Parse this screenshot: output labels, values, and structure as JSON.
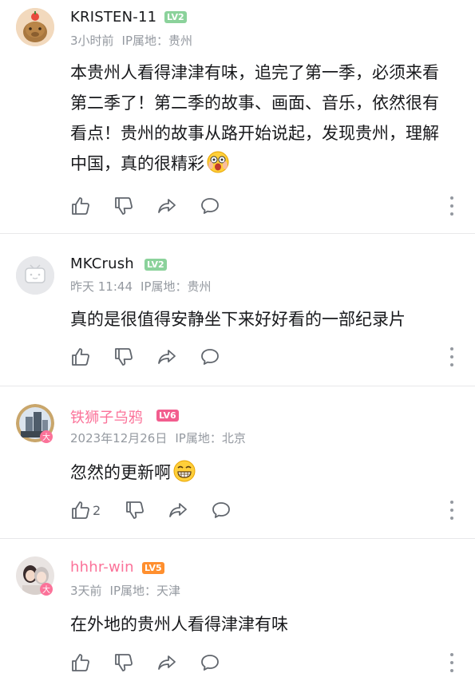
{
  "comments": [
    {
      "username": "KRISTEN-11",
      "level": "LV2",
      "level_color": "#8bd29b",
      "name_color": "#18191c",
      "time": "3小时前",
      "ip": "IP属地：贵州",
      "text": "本贵州人看得津津有味，追完了第一季，必须来看第二季了！第二季的故事、画面、音乐，依然很有看点！贵州的故事从路开始说起，发现贵州，理解中国，真的很精彩",
      "emoji": "scared-face-emoji",
      "likes": "",
      "avatar_icon": "capybara-avatar"
    },
    {
      "username": "MKCrush",
      "level": "LV2",
      "level_color": "#8bd29b",
      "name_color": "#18191c",
      "time": "昨天 11:44",
      "ip": "IP属地：贵州",
      "text": "真的是很值得安静坐下来好好看的一部纪录片",
      "likes": "",
      "avatar_icon": "default-tv-avatar"
    },
    {
      "username": "铁狮子乌鸦",
      "level": "LV6",
      "level_color": "#f25d8e",
      "name_color": "#fb7299",
      "time": "2023年12月26日",
      "ip": "IP属地：北京",
      "text": "忽然的更新啊",
      "emoji": "grinning-emoji",
      "likes": "2",
      "avatar_icon": "building-avatar"
    },
    {
      "username": "hhhr-win",
      "level": "LV5",
      "level_color": "#ff8f2e",
      "name_color": "#fb7299",
      "time": "3天前",
      "ip": "IP属地：天津",
      "text": "在外地的贵州人看得津津有味",
      "likes": "",
      "avatar_icon": "photo-avatar"
    }
  ],
  "colors": {
    "text": "#18191c",
    "meta": "#9499a0",
    "divider": "#e8e8ea",
    "vip_pink": "#fb7299"
  }
}
